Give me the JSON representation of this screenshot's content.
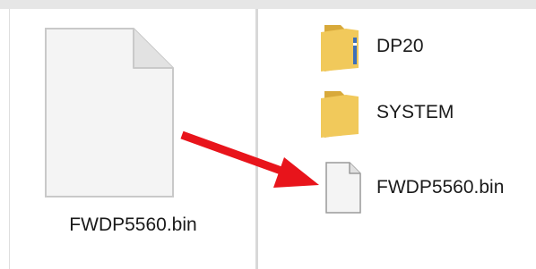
{
  "left_pane": {
    "file": {
      "name": "FWDP5560.bin",
      "icon": "document-icon"
    }
  },
  "right_pane": {
    "items": [
      {
        "name": "DP20",
        "icon": "folder-icon"
      },
      {
        "name": "SYSTEM",
        "icon": "folder-icon"
      },
      {
        "name": "FWDP5560.bin",
        "icon": "document-icon"
      }
    ]
  },
  "annotation": {
    "color": "#e8141b",
    "icon": "arrow-right-icon"
  }
}
